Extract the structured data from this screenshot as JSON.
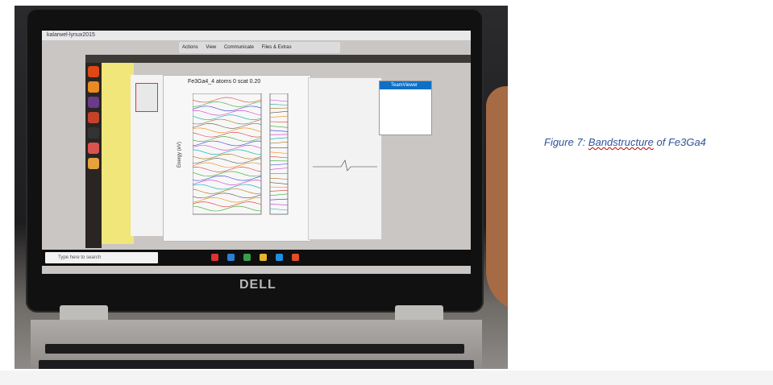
{
  "caption": {
    "prefix": "Figure 7: ",
    "underlined": "Bandstructure",
    "middle": " of ",
    "suffix": "Fe3Ga4"
  },
  "photo": {
    "remote_desktop_title": "kalarwel-lynux2015",
    "remote_toolbar": [
      "Actions",
      "View",
      "Communicate",
      "Files & Extras"
    ],
    "pdf_title": "Fe3Ga4_4 atoms  0    scat 0.20",
    "y_axis_label": "Energy (eV)",
    "teamviewer_title": "TeamViewer",
    "search_placeholder": "Type here to search",
    "laptop_brand": "DELL"
  },
  "colors": {
    "caption": "#2f5496",
    "teamviewer_blue": "#0e6fc6",
    "ubuntu_launcher": "#2a2522"
  }
}
